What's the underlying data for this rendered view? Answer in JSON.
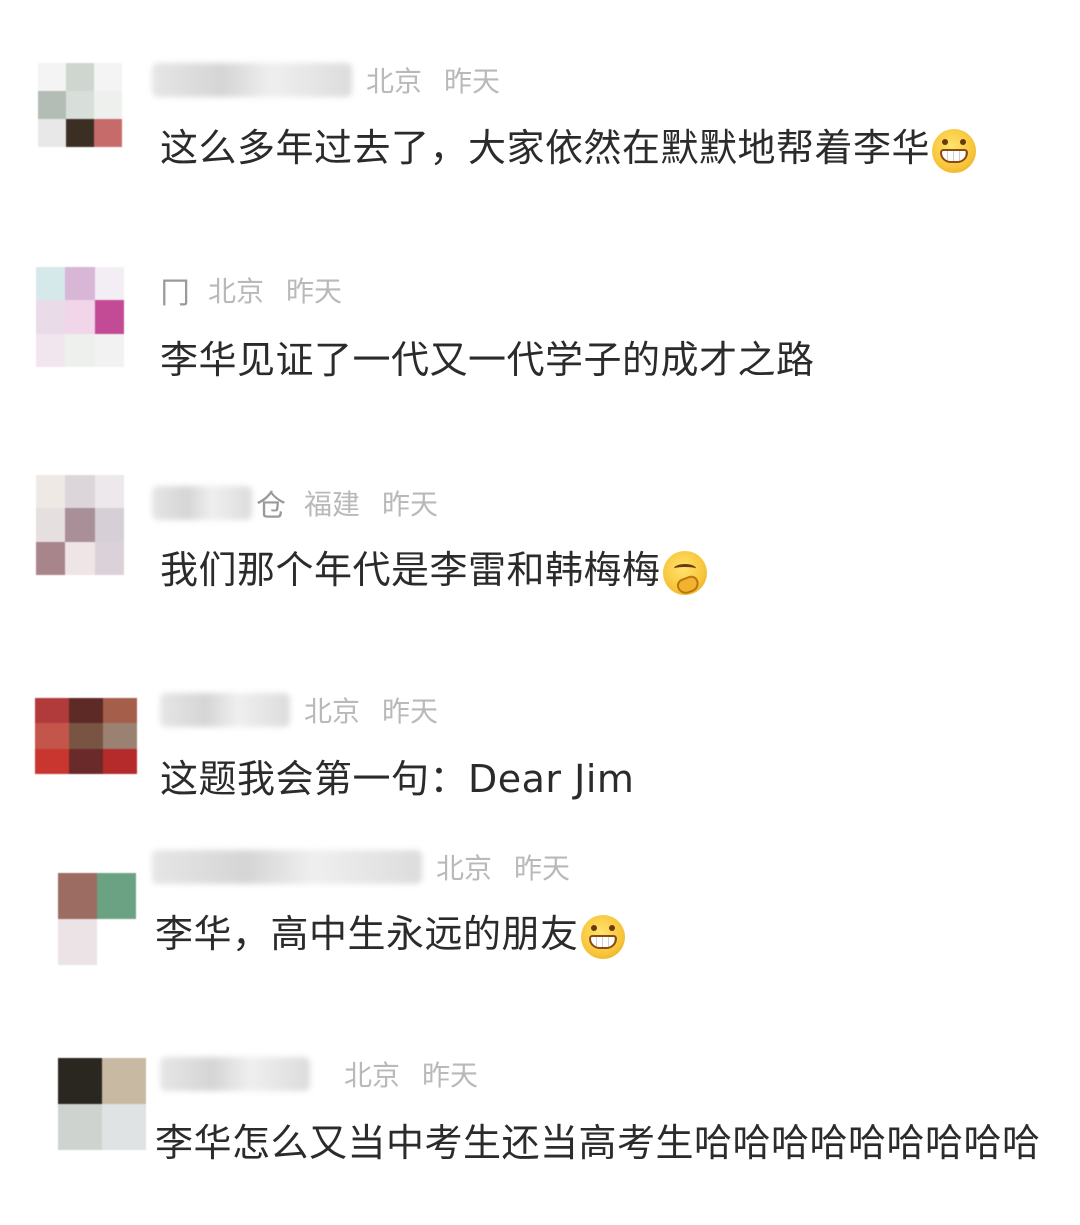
{
  "comments": [
    {
      "name_tail": "",
      "location": "北京",
      "time": "昨天",
      "text": "这么多年过去了，大家依然在默默地帮着李华",
      "emoji": "grin-emoji",
      "avatar": [
        "#f4f4f4",
        "#cfd5cf",
        "#f4f4f4",
        "#b3bcb5",
        "#d8dfda",
        "#eef0ee",
        "#e8e8e8",
        "#3b2f23",
        "#c66a6a"
      ]
    },
    {
      "name_tail": "冂",
      "location": "北京",
      "time": "昨天",
      "text": "李华见证了一代又一代学子的成才之路",
      "emoji": "",
      "avatar": [
        "#d6e9ea",
        "#d8b6d6",
        "#f3eef3",
        "#eadbe8",
        "#f0d6e8",
        "#c34a95",
        "#f2e6ee",
        "#eef0ee",
        "#f2f2f2"
      ]
    },
    {
      "name_tail": "仓",
      "location": "福建",
      "time": "昨天",
      "text": "我们那个年代是李雷和韩梅梅",
      "emoji": "thinking-emoji",
      "avatar": [
        "#efe9e6",
        "#dcd6da",
        "#ece8ec",
        "#e6dfe0",
        "#a98f98",
        "#d6cfd6",
        "#a8858a",
        "#efe4e6",
        "#dad2d8"
      ]
    },
    {
      "name_tail": "",
      "location": "北京",
      "time": "昨天",
      "text": "这题我会第一句：Dear Jim",
      "emoji": "",
      "avatar": [
        "#b13a3a",
        "#5e2a26",
        "#a45e4a",
        "#c4554a",
        "#7a5442",
        "#9b8172",
        "#c8362f",
        "#6a2a2a",
        "#b52b2b"
      ]
    },
    {
      "name_tail": "",
      "location": "北京",
      "time": "昨天",
      "text": "李华，高中生永远的朋友",
      "emoji": "grin-emoji",
      "avatar": [
        "#9c6b61",
        "#6ba284",
        "#ebe3e6",
        "#ffffff"
      ]
    },
    {
      "name_tail": "",
      "location": "北京",
      "time": "昨天",
      "text": "李华怎么又当中考生还当高考生哈哈哈哈哈哈哈哈哈",
      "emoji": "",
      "avatar": [
        "#2a2620",
        "#c8b9a2",
        "#cfd3d0",
        "#dfe3e3"
      ]
    }
  ]
}
